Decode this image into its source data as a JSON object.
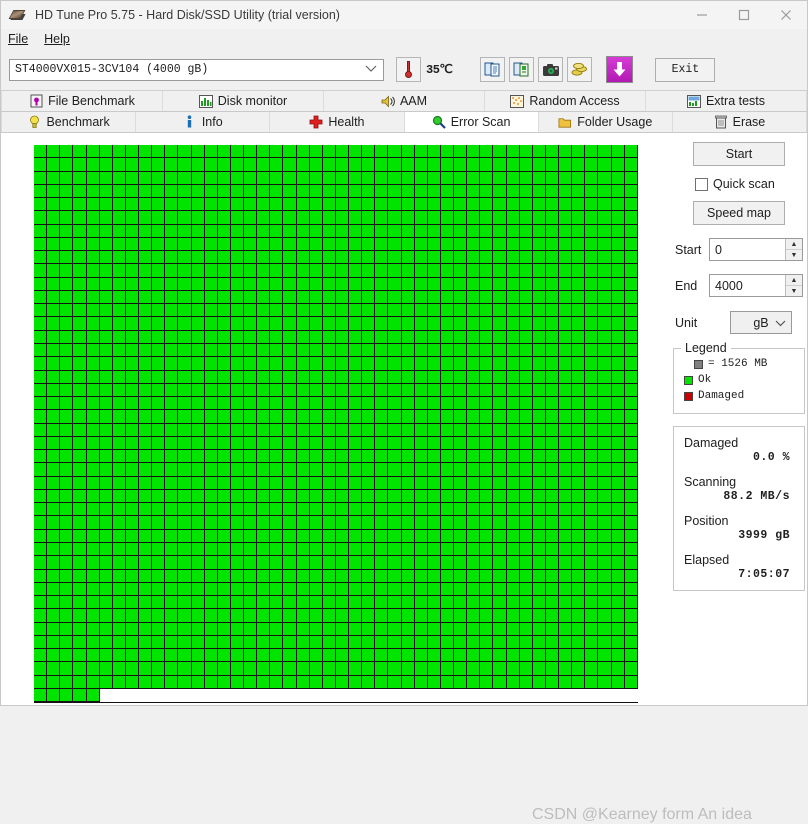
{
  "window": {
    "title": "HD Tune Pro 5.75 - Hard Disk/SSD Utility (trial version)",
    "icon": "harddisk-icon",
    "minimize_label": "—",
    "maximize_label": "□",
    "close_label": "✕"
  },
  "menu": {
    "items": [
      {
        "label": "File",
        "accel": "F"
      },
      {
        "label": "Help",
        "accel": "H"
      }
    ]
  },
  "toolbar": {
    "drive_selected": "ST4000VX015-3CV104  (4000  gB)",
    "dropdown_arrow": "⌄",
    "temperature": "35℃",
    "temp_icon": "thermometer-icon",
    "buttons": [
      {
        "name": "copy-to-clipboard-button",
        "icon": "copy-icon"
      },
      {
        "name": "export-button",
        "icon": "export-document-icon"
      },
      {
        "name": "screenshot-button",
        "icon": "camera-icon"
      },
      {
        "name": "settings-button",
        "icon": "coins-icon"
      }
    ],
    "download_button": {
      "name": "download-button",
      "icon": "download-arrow-icon"
    },
    "exit_label": "Exit"
  },
  "tabs": {
    "row1": [
      {
        "label": "File Benchmark",
        "icon": "file-benchmark-icon",
        "active": false
      },
      {
        "label": "Disk monitor",
        "icon": "disk-monitor-icon",
        "active": false
      },
      {
        "label": "AAM",
        "icon": "speaker-icon",
        "active": false
      },
      {
        "label": "Random Access",
        "icon": "random-access-icon",
        "active": false
      },
      {
        "label": "Extra tests",
        "icon": "extra-tests-icon",
        "active": false
      }
    ],
    "row2": [
      {
        "label": "Benchmark",
        "icon": "lightbulb-icon",
        "active": false
      },
      {
        "label": "Info",
        "icon": "info-icon",
        "active": false
      },
      {
        "label": "Health",
        "icon": "health-cross-icon",
        "active": false
      },
      {
        "label": "Error Scan",
        "icon": "magnifier-icon",
        "active": true
      },
      {
        "label": "Folder Usage",
        "icon": "folder-icon",
        "active": false
      },
      {
        "label": "Erase",
        "icon": "trash-icon",
        "active": false
      }
    ]
  },
  "panel": {
    "start_button": "Start",
    "quick_scan_label": "Quick scan",
    "quick_scan_checked": false,
    "speed_map_button": "Speed map",
    "start_field": {
      "label": "Start",
      "value": "0"
    },
    "end_field": {
      "label": "End",
      "value": "4000"
    },
    "unit_field": {
      "label": "Unit",
      "value": "gB",
      "arrow": "⌄"
    },
    "legend": {
      "caption": "Legend",
      "block_size": "=  1526  MB",
      "ok_label": "Ok",
      "damaged_label": "Damaged",
      "block_color": "#808080",
      "ok_color": "#00e400",
      "damaged_color": "#cc0000"
    },
    "stats": [
      {
        "label": "Damaged",
        "value": "0.0  %"
      },
      {
        "label": "Scanning",
        "value": "88.2  MB/s"
      },
      {
        "label": "Position",
        "value": "3999  gB"
      },
      {
        "label": "Elapsed",
        "value": "7:05:07"
      }
    ]
  },
  "scan_grid": {
    "columns": 46,
    "rows": 42,
    "last_row_filled": 5,
    "ok_color": "#00e400",
    "damaged_color": "#d40000",
    "background_color": "#131313"
  },
  "watermark": "CSDN @Kearney form An idea"
}
